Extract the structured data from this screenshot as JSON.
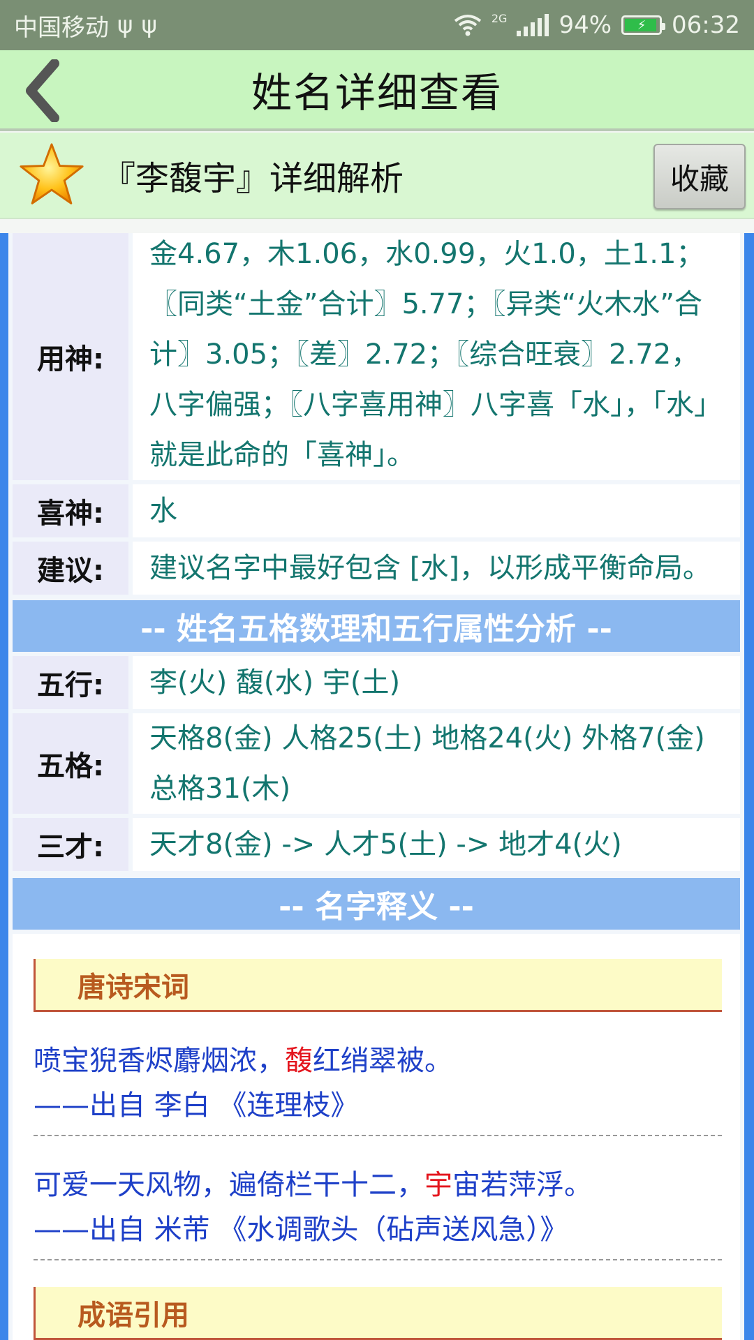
{
  "status_bar": {
    "carrier": "中国移动",
    "network_type": "2G",
    "battery": "94%",
    "battery_level": 0.94,
    "time": "06:32"
  },
  "header": {
    "title": "姓名详细查看"
  },
  "subheader": {
    "title": "『李馥宇』详细解析",
    "favorite_label": "收藏"
  },
  "rows_top": [
    {
      "label": "用神:",
      "value": "金4.67，木1.06，水0.99，火1.0，土1.1；〖同类“土金”合计〗5.77；〖异类“火木水”合计〗3.05；〖差〗2.72；〖综合旺衰〗2.72，八字偏强；〖八字喜用神〗八字喜「水」，「水」就是此命的「喜神」。"
    },
    {
      "label": "喜神:",
      "value": "水"
    },
    {
      "label": "建议:",
      "value": "建议名字中最好包含 [水]，以形成平衡命局。"
    }
  ],
  "section1": {
    "title": "-- 姓名五格数理和五行属性分析 --"
  },
  "rows_analysis": [
    {
      "label": "五行:",
      "value": "李(火) 馥(水) 宇(土)"
    },
    {
      "label": "五格:",
      "value": "天格8(金) 人格25(土) 地格24(火) 外格7(金) 总格31(木)"
    },
    {
      "label": "三才:",
      "value": "天才8(金) -> 人才5(土) -> 地才4(火)"
    }
  ],
  "section2": {
    "title": "-- 名字释义 --"
  },
  "categories": {
    "poems": "唐诗宋词",
    "idioms": "成语引用"
  },
  "poems": [
    {
      "before": "喷宝猊香烬麝烟浓，",
      "highlight": "馥",
      "after": "红绡翠被。",
      "source": "——出自 李白 《连理枝》"
    },
    {
      "before": "可爱一天风物，遍倚栏干十二，",
      "highlight": "宇",
      "after": "宙若萍浮。",
      "source": "——出自 米芾 《水调歌头（砧声送风急）》"
    }
  ]
}
